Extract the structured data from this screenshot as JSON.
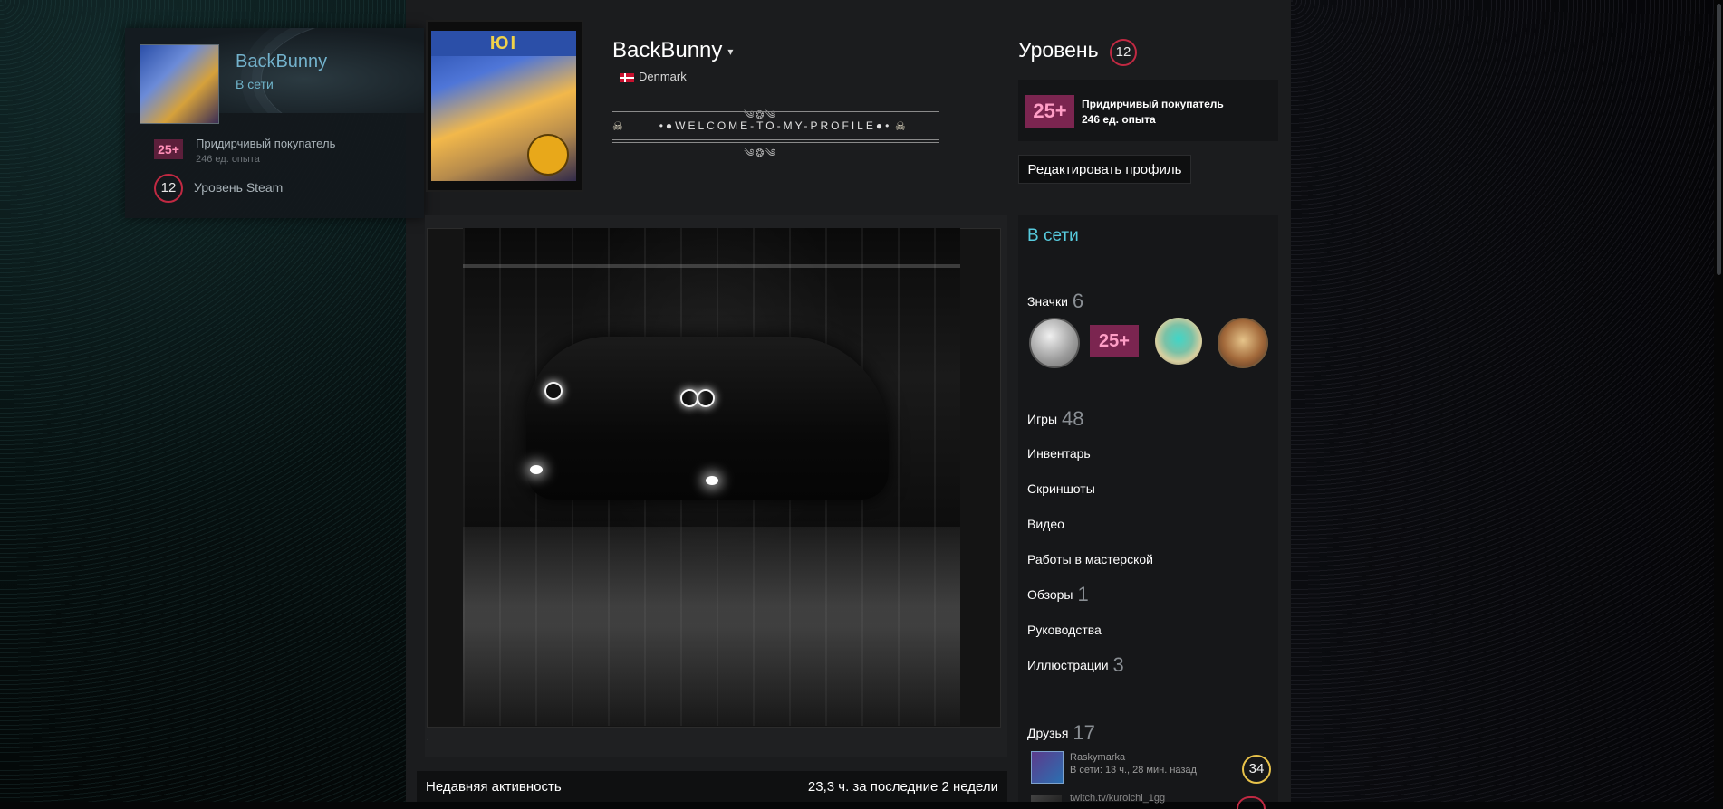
{
  "colors": {
    "accent_online": "#57cbde",
    "level_ring": "#c02942",
    "friend_level_ring": "#e8c24a",
    "badge_pink": "#7b2550"
  },
  "mini_profile": {
    "name": "BackBunny",
    "status": "В сети",
    "badge_icon_text": "25+",
    "badge_name": "Придирчивый покупатель",
    "badge_xp": "246 ед. опыта",
    "level": "12",
    "level_label": "Уровень Steam"
  },
  "header": {
    "avatar_title": "ЮI",
    "persona_name": "BackBunny",
    "country": "Denmark",
    "summary_ornament_top": "༄❂༄",
    "summary_text": "•●WELCOME-TO-MY-PROFILE●•",
    "summary_ornament_bottom": "༄❂༄",
    "skull": "☠"
  },
  "level_panel": {
    "title": "Уровень",
    "level": "12",
    "badge_icon_text": "25+",
    "badge_name": "Придирчивый покупатель",
    "badge_xp": "246 ед. опыта",
    "edit_button": "Редактировать профиль"
  },
  "showcase": {
    "caption": "."
  },
  "recent_activity": {
    "label": "Недавняя активность",
    "hours": "23,3 ч. за последние 2 недели"
  },
  "right_column": {
    "status": "В сети",
    "badges_label": "Значки",
    "badges_count": "6",
    "badge2_text": "25+",
    "games_label": "Игры",
    "games_count": "48",
    "inventory_label": "Инвентарь",
    "screenshots_label": "Скриншоты",
    "videos_label": "Видео",
    "workshop_label": "Работы в мастерской",
    "reviews_label": "Обзоры",
    "reviews_count": "1",
    "guides_label": "Руководства",
    "artwork_label": "Иллюстрации",
    "artwork_count": "3",
    "friends_label": "Друзья",
    "friends_count": "17"
  },
  "friends": [
    {
      "name": "Raskymarka",
      "last_online": "В сети: 13 ч., 28 мин. назад",
      "level": "34"
    },
    {
      "name": "twitch.tv/kuroichi_1gg"
    }
  ],
  "icons": {
    "caret": "▾",
    "country_flag": "flag-dk-icon"
  }
}
